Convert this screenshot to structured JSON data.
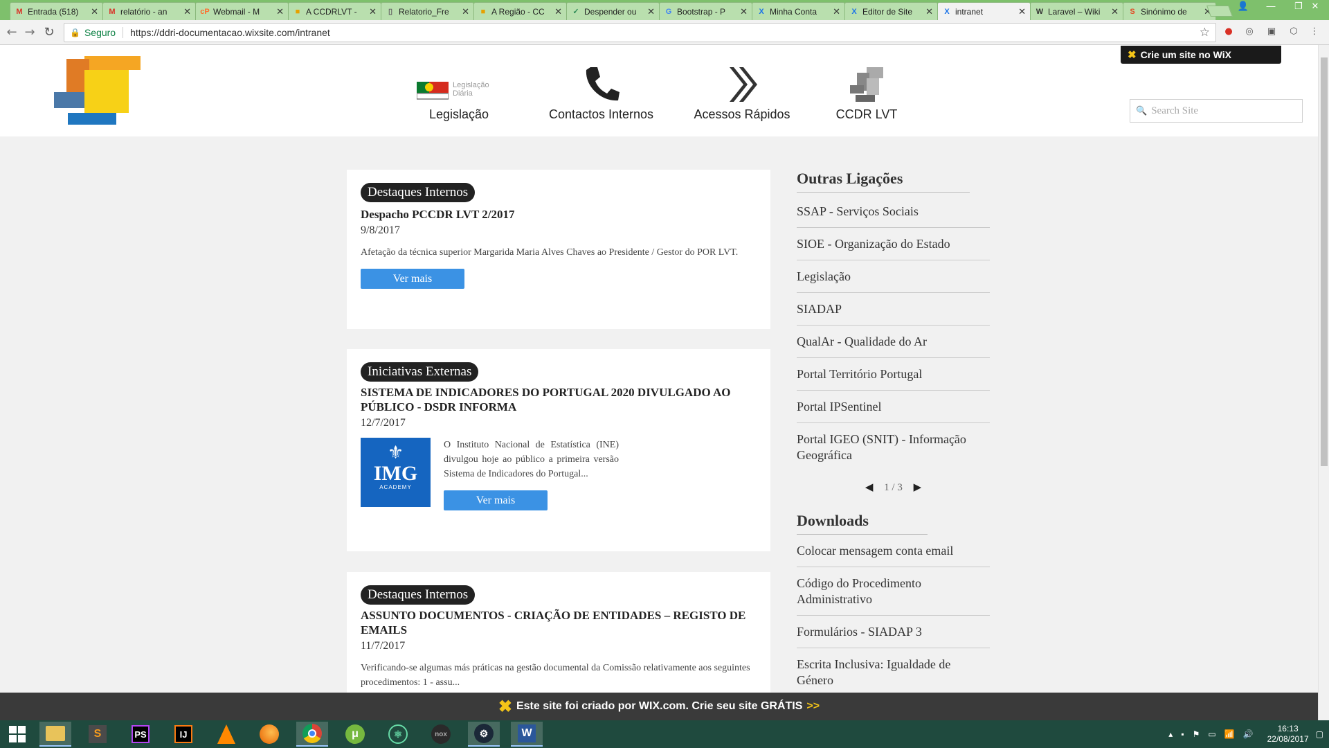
{
  "tabs": [
    {
      "label": "Entrada (518)",
      "fav": "M",
      "fav_color": "#d93025"
    },
    {
      "label": "relatório - an",
      "fav": "M",
      "fav_color": "#d93025"
    },
    {
      "label": "Webmail - M",
      "fav": "cP",
      "fav_color": "#ff6c2c"
    },
    {
      "label": "A CCDRLVT -",
      "fav": "■",
      "fav_color": "#e6a100"
    },
    {
      "label": "Relatorio_Fre",
      "fav": "▯",
      "fav_color": "#666666"
    },
    {
      "label": "A Região - CC",
      "fav": "■",
      "fav_color": "#e6a100"
    },
    {
      "label": "Despender ou",
      "fav": "✓",
      "fav_color": "#2e8b57"
    },
    {
      "label": "Bootstrap - P",
      "fav": "G",
      "fav_color": "#4285f4"
    },
    {
      "label": "Minha Conta",
      "fav": "X",
      "fav_color": "#1a73e8"
    },
    {
      "label": "Editor de Site",
      "fav": "X",
      "fav_color": "#1a73e8"
    },
    {
      "label": "intranet",
      "fav": "X",
      "fav_color": "#1a73e8",
      "active": true
    },
    {
      "label": "Laravel – Wiki",
      "fav": "W",
      "fav_color": "#333333"
    },
    {
      "label": "Sinónimo de",
      "fav": "S",
      "fav_color": "#e34c26"
    }
  ],
  "address": {
    "secure_label": "Seguro",
    "url": "https://ddri-documentacao.wixsite.com/intranet"
  },
  "wix_badge": "Crie um site no WiX",
  "nav": [
    {
      "label": "Legislação",
      "icon": "diario-republica-icon",
      "sublabel": "Legislação Diária"
    },
    {
      "label": "Contactos Internos",
      "icon": "phone-icon"
    },
    {
      "label": "Acessos Rápidos",
      "icon": "double-chevron-icon"
    },
    {
      "label": "CCDR LVT",
      "icon": "ccdr-logo-icon"
    }
  ],
  "search": {
    "placeholder": "Search Site"
  },
  "posts": [
    {
      "category": "Destaques Internos",
      "title": "Despacho PCCDR LVT 2/2017",
      "date": "9/8/2017",
      "description": "Afetação da técnica superior Margarida Maria Alves Chaves ao Presidente / Gestor do POR LVT.",
      "button": "Ver mais"
    },
    {
      "category": "Iniciativas Externas",
      "title": "SISTEMA DE INDICADORES DO PORTUGAL 2020 DIVULGADO AO PÚBLICO - DSDR INFORMA",
      "date": "12/7/2017",
      "description": "O Instituto Nacional de Estatística (INE) divulgou hoje ao público a primeira versão Sistema de Indicadores do Portugal...",
      "thumb_text": "IMG",
      "thumb_sub": "ACADEMY",
      "button": "Ver mais"
    },
    {
      "category": "Destaques Internos",
      "title": "ASSUNTO DOCUMENTOS - CRIAÇÃO DE ENTIDADES – REGISTO DE EMAILS",
      "date": "11/7/2017",
      "description": "Verificando-se algumas más práticas na gestão documental da Comissão relativamente aos seguintes procedimentos: 1 - assu..."
    }
  ],
  "sidebar": {
    "links_title": "Outras Ligações",
    "links": [
      "SSAP - Serviços Sociais",
      "SIOE - Organização do Estado",
      "Legislação",
      "SIADAP",
      "QualAr - Qualidade do Ar",
      "Portal Território Portugal",
      "Portal IPSentinel",
      "Portal IGEO (SNIT) - Informação Geográfica"
    ],
    "pager": "1 / 3",
    "downloads_title": "Downloads",
    "downloads": [
      "Colocar mensagem conta email",
      "Código do Procedimento Administrativo",
      "Formulários - SIADAP 3",
      "Escrita Inclusiva: Igualdade de Género"
    ]
  },
  "wix_banner": {
    "text": "Este site foi criado por WIX.com. Crie seu site GRÁTIS",
    "arrow": ">>"
  },
  "taskbar": {
    "apps": [
      "windows-start",
      "file-explorer",
      "sublime-text",
      "phpstorm",
      "intellij",
      "vlc",
      "firefox",
      "chrome",
      "utorrent",
      "atom",
      "nox",
      "steam",
      "word"
    ],
    "time": "16:13",
    "date": "22/08/2017"
  },
  "colors": {
    "accent": "#3b92e4",
    "tab_bar": "#7ec06c",
    "taskbar": "#1f4a3e"
  }
}
